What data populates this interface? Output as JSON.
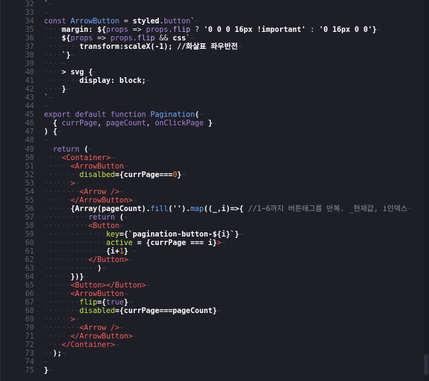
{
  "editor": {
    "lines": [
      {
        "n": "32",
        "tokens": [
          {
            "t": "`",
            "c": "t-txt"
          },
          {
            "t": "~",
            "c": "ws"
          }
        ]
      },
      {
        "n": "33",
        "tokens": [
          {
            "t": "~",
            "c": "ws"
          }
        ]
      },
      {
        "n": "34",
        "tokens": [
          {
            "t": "const ",
            "c": "t-kw"
          },
          {
            "t": "ArrowButton",
            "c": "t-fn"
          },
          {
            "t": " = ",
            "c": "t-txt"
          },
          {
            "t": "styled",
            "c": "t-bold"
          },
          {
            "t": ".",
            "c": "t-txt"
          },
          {
            "t": "button",
            "c": "t-kw"
          },
          {
            "t": "`",
            "c": "t-txt"
          },
          {
            "t": "~",
            "c": "ws"
          }
        ]
      },
      {
        "n": "35",
        "tokens": [
          {
            "t": "····",
            "c": "ws"
          },
          {
            "t": "margin: ",
            "c": "t-bold"
          },
          {
            "t": "${",
            "c": "t-bold"
          },
          {
            "t": "props",
            "c": "t-kw"
          },
          {
            "t": " => ",
            "c": "t-txt"
          },
          {
            "t": "props",
            "c": "t-kw"
          },
          {
            "t": ".flip",
            "c": "t-prop"
          },
          {
            "t": " ? ",
            "c": "t-txt"
          },
          {
            "t": "'0 0 0 16px !important'",
            "c": "t-bold"
          },
          {
            "t": " : ",
            "c": "t-txt"
          },
          {
            "t": "'0 16px 0 0'",
            "c": "t-bold"
          },
          {
            "t": "}",
            "c": "t-bold"
          },
          {
            "t": "~",
            "c": "ws"
          }
        ]
      },
      {
        "n": "36",
        "tokens": [
          {
            "t": "····",
            "c": "ws"
          },
          {
            "t": "${",
            "c": "t-bold"
          },
          {
            "t": "props",
            "c": "t-kw"
          },
          {
            "t": " => ",
            "c": "t-txt"
          },
          {
            "t": "props",
            "c": "t-kw"
          },
          {
            "t": ".flip",
            "c": "t-prop"
          },
          {
            "t": " && ",
            "c": "t-txt"
          },
          {
            "t": "css",
            "c": "t-bold"
          },
          {
            "t": "`",
            "c": "t-txt"
          },
          {
            "t": "~",
            "c": "ws"
          }
        ]
      },
      {
        "n": "37",
        "tokens": [
          {
            "t": "········",
            "c": "ws"
          },
          {
            "t": "transform:scaleX(-1); //화살표 좌우반전",
            "c": "t-bold"
          },
          {
            "t": "~",
            "c": "ws"
          }
        ]
      },
      {
        "n": "38",
        "tokens": [
          {
            "t": "····",
            "c": "ws"
          },
          {
            "t": "`}",
            "c": "t-bold"
          },
          {
            "t": "~",
            "c": "ws"
          }
        ]
      },
      {
        "n": "39",
        "tokens": [
          {
            "t": "····",
            "c": "ws"
          },
          {
            "t": "~",
            "c": "ws"
          }
        ]
      },
      {
        "n": "40",
        "tokens": [
          {
            "t": "····",
            "c": "ws"
          },
          {
            "t": "> svg {",
            "c": "t-bold"
          },
          {
            "t": "~",
            "c": "ws"
          }
        ]
      },
      {
        "n": "41",
        "tokens": [
          {
            "t": "········",
            "c": "ws"
          },
          {
            "t": "display: block;",
            "c": "t-bold"
          },
          {
            "t": "~",
            "c": "ws"
          }
        ]
      },
      {
        "n": "42",
        "tokens": [
          {
            "t": "····",
            "c": "ws"
          },
          {
            "t": "}",
            "c": "t-bold"
          },
          {
            "t": "~",
            "c": "ws"
          }
        ]
      },
      {
        "n": "43",
        "tokens": [
          {
            "t": "`",
            "c": "t-txt"
          },
          {
            "t": "~",
            "c": "ws"
          }
        ]
      },
      {
        "n": "44",
        "tokens": [
          {
            "t": "~",
            "c": "ws"
          }
        ]
      },
      {
        "n": "45",
        "tokens": [
          {
            "t": "export ",
            "c": "t-kw"
          },
          {
            "t": "default ",
            "c": "t-kw"
          },
          {
            "t": "function ",
            "c": "t-kw"
          },
          {
            "t": "Pagination",
            "c": "t-fn"
          },
          {
            "t": "(",
            "c": "t-bold"
          },
          {
            "t": "~",
            "c": "ws"
          }
        ]
      },
      {
        "n": "46",
        "tokens": [
          {
            "t": "··",
            "c": "ws"
          },
          {
            "t": "{ ",
            "c": "t-bold"
          },
          {
            "t": "currPage",
            "c": "t-kw"
          },
          {
            "t": ", ",
            "c": "t-txt"
          },
          {
            "t": "pageCount",
            "c": "t-kw"
          },
          {
            "t": ", ",
            "c": "t-txt"
          },
          {
            "t": "onClickPage",
            "c": "t-kw"
          },
          {
            "t": " }",
            "c": "t-bold"
          },
          {
            "t": "~",
            "c": "ws"
          }
        ]
      },
      {
        "n": "47",
        "tokens": [
          {
            "t": ") {",
            "c": "t-bold"
          },
          {
            "t": "~",
            "c": "ws"
          }
        ]
      },
      {
        "n": "48",
        "tokens": [
          {
            "t": "~",
            "c": "ws"
          }
        ]
      },
      {
        "n": "49",
        "tokens": [
          {
            "t": "··",
            "c": "ws"
          },
          {
            "t": "return ",
            "c": "t-kw"
          },
          {
            "t": "(",
            "c": "t-bold"
          },
          {
            "t": "~",
            "c": "ws"
          }
        ]
      },
      {
        "n": "50",
        "tokens": [
          {
            "t": "····",
            "c": "ws"
          },
          {
            "t": "<Container>",
            "c": "t-tag"
          },
          {
            "t": "~",
            "c": "ws"
          }
        ]
      },
      {
        "n": "51",
        "tokens": [
          {
            "t": "······",
            "c": "ws"
          },
          {
            "t": "<ArrowButton",
            "c": "t-tag"
          },
          {
            "t": "~",
            "c": "ws"
          }
        ]
      },
      {
        "n": "52",
        "tokens": [
          {
            "t": "········",
            "c": "ws"
          },
          {
            "t": "disalbed",
            "c": "t-attr"
          },
          {
            "t": "={",
            "c": "t-bold"
          },
          {
            "t": "currPage===",
            "c": "t-bold"
          },
          {
            "t": "0",
            "c": "t-num"
          },
          {
            "t": "}",
            "c": "t-bold"
          },
          {
            "t": "~",
            "c": "ws"
          }
        ]
      },
      {
        "n": "53",
        "tokens": [
          {
            "t": "······",
            "c": "ws"
          },
          {
            "t": ">",
            "c": "t-tag"
          },
          {
            "t": "~",
            "c": "ws"
          }
        ]
      },
      {
        "n": "54",
        "tokens": [
          {
            "t": "········",
            "c": "ws"
          },
          {
            "t": "<Arrow />",
            "c": "t-tag"
          },
          {
            "t": "~",
            "c": "ws"
          }
        ]
      },
      {
        "n": "55",
        "tokens": [
          {
            "t": "······",
            "c": "ws"
          },
          {
            "t": "</ArrowButton>",
            "c": "t-tag"
          },
          {
            "t": "~",
            "c": "ws"
          }
        ]
      },
      {
        "n": "56",
        "tokens": [
          {
            "t": "······",
            "c": "ws"
          },
          {
            "t": "{Array(pageCount).",
            "c": "t-bold"
          },
          {
            "t": "fill",
            "c": "t-fn"
          },
          {
            "t": "('').",
            "c": "t-bold"
          },
          {
            "t": "map",
            "c": "t-fn"
          },
          {
            "t": "((_,i)=>{ ",
            "c": "t-bold"
          },
          {
            "t": "//1~6까지 버튼태그를 반복. _현재값, i인덱스",
            "c": "t-com"
          },
          {
            "t": "~",
            "c": "ws"
          }
        ]
      },
      {
        "n": "57",
        "tokens": [
          {
            "t": "··········",
            "c": "ws"
          },
          {
            "t": "return ",
            "c": "t-kw"
          },
          {
            "t": "(",
            "c": "t-bold"
          },
          {
            "t": "~",
            "c": "ws"
          }
        ]
      },
      {
        "n": "58",
        "tokens": [
          {
            "t": "··········",
            "c": "ws"
          },
          {
            "t": "<Button",
            "c": "t-tag"
          },
          {
            "t": "~",
            "c": "ws"
          }
        ]
      },
      {
        "n": "59",
        "tokens": [
          {
            "t": "··············",
            "c": "ws"
          },
          {
            "t": "key",
            "c": "t-attr"
          },
          {
            "t": "={`pagination-button-${i}`}",
            "c": "t-bold"
          },
          {
            "t": "~",
            "c": "ws"
          }
        ]
      },
      {
        "n": "60",
        "tokens": [
          {
            "t": "··············",
            "c": "ws"
          },
          {
            "t": "active",
            "c": "t-attr"
          },
          {
            "t": " = {currPage === i}",
            "c": "t-bold"
          },
          {
            "t": ">",
            "c": "t-tag"
          },
          {
            "t": "~",
            "c": "ws"
          }
        ]
      },
      {
        "n": "61",
        "tokens": [
          {
            "t": "··············",
            "c": "ws"
          },
          {
            "t": "{i+",
            "c": "t-bold"
          },
          {
            "t": "1",
            "c": "t-num"
          },
          {
            "t": "}",
            "c": "t-bold"
          },
          {
            "t": " ~",
            "c": "ws"
          }
        ]
      },
      {
        "n": "62",
        "tokens": [
          {
            "t": "··········",
            "c": "ws"
          },
          {
            "t": "</Button>",
            "c": "t-tag"
          },
          {
            "t": "~",
            "c": "ws"
          }
        ]
      },
      {
        "n": "63",
        "tokens": [
          {
            "t": "············",
            "c": "ws"
          },
          {
            "t": ")",
            "c": "t-bold"
          },
          {
            "t": "~",
            "c": "ws"
          }
        ]
      },
      {
        "n": "64",
        "tokens": [
          {
            "t": "······",
            "c": "ws"
          },
          {
            "t": "})}",
            "c": "t-bold"
          },
          {
            "t": "~",
            "c": "ws"
          }
        ]
      },
      {
        "n": "65",
        "tokens": [
          {
            "t": "······",
            "c": "ws"
          },
          {
            "t": "<Button></Button>",
            "c": "t-tag"
          },
          {
            "t": "~",
            "c": "ws"
          }
        ]
      },
      {
        "n": "66",
        "tokens": [
          {
            "t": "······",
            "c": "ws"
          },
          {
            "t": "<ArrowButton",
            "c": "t-tag"
          },
          {
            "t": "~",
            "c": "ws"
          }
        ]
      },
      {
        "n": "67",
        "tokens": [
          {
            "t": "········",
            "c": "ws"
          },
          {
            "t": "flip",
            "c": "t-attr"
          },
          {
            "t": "={",
            "c": "t-bold"
          },
          {
            "t": "true",
            "c": "t-kw"
          },
          {
            "t": "}",
            "c": "t-bold"
          },
          {
            "t": "~",
            "c": "ws"
          }
        ]
      },
      {
        "n": "68",
        "tokens": [
          {
            "t": "········",
            "c": "ws"
          },
          {
            "t": "disabled",
            "c": "t-attr"
          },
          {
            "t": "={currPage===pageCount}",
            "c": "t-bold"
          },
          {
            "t": "~",
            "c": "ws"
          }
        ]
      },
      {
        "n": "69",
        "tokens": [
          {
            "t": "······",
            "c": "ws"
          },
          {
            "t": ">",
            "c": "t-tag"
          },
          {
            "t": "~",
            "c": "ws"
          }
        ]
      },
      {
        "n": "70",
        "tokens": [
          {
            "t": "········",
            "c": "ws"
          },
          {
            "t": "<Arrow />",
            "c": "t-tag"
          },
          {
            "t": "~",
            "c": "ws"
          }
        ]
      },
      {
        "n": "71",
        "tokens": [
          {
            "t": "······",
            "c": "ws"
          },
          {
            "t": "</ArrowButton>",
            "c": "t-tag"
          },
          {
            "t": "~",
            "c": "ws"
          }
        ]
      },
      {
        "n": "72",
        "tokens": [
          {
            "t": "····",
            "c": "ws"
          },
          {
            "t": "</Container>",
            "c": "t-tag"
          },
          {
            "t": "~",
            "c": "ws"
          }
        ]
      },
      {
        "n": "73",
        "tokens": [
          {
            "t": "··",
            "c": "ws"
          },
          {
            "t": ");",
            "c": "t-bold"
          },
          {
            "t": "~",
            "c": "ws"
          }
        ]
      },
      {
        "n": "74",
        "tokens": [
          {
            "t": "~",
            "c": "ws"
          }
        ]
      },
      {
        "n": "75",
        "tokens": [
          {
            "t": "}",
            "c": "t-bold"
          },
          {
            "t": "~",
            "c": "ws"
          }
        ]
      }
    ]
  }
}
